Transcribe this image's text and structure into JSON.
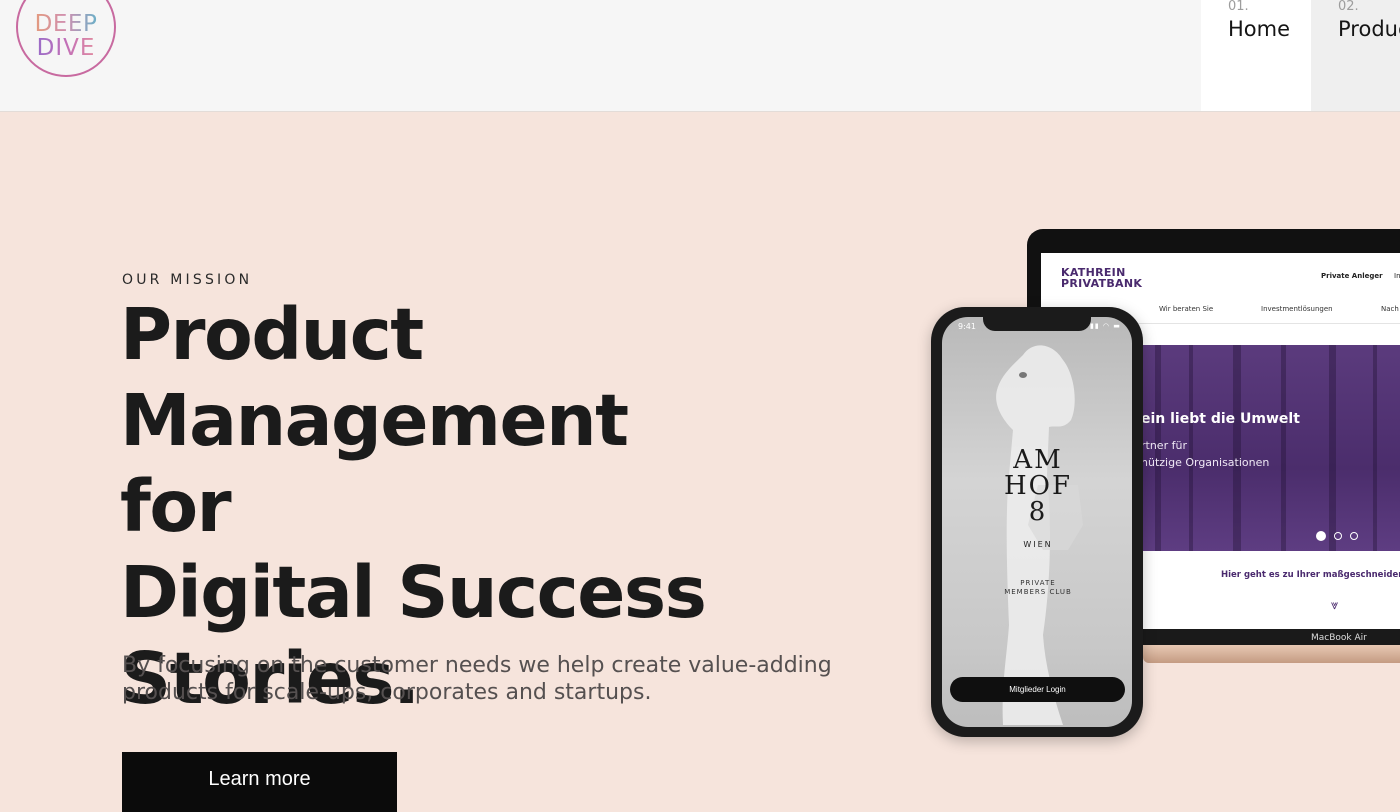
{
  "header": {
    "logo_line1": "DEEP",
    "logo_line2": "DIVE",
    "nav": [
      {
        "num": "01.",
        "label": "Home"
      },
      {
        "num": "02.",
        "label": "Products"
      }
    ]
  },
  "hero": {
    "eyebrow": "OUR MISSION",
    "headline_lines": [
      "Product",
      "Management for",
      "Digital Success",
      "Stories."
    ],
    "subtitle_lines": [
      "By focusing on the customer needs we help create value-adding",
      "products for scale-ups, corporates and startups."
    ],
    "cta_label": "Learn more"
  },
  "laptop": {
    "brand_line1": "KATHREIN",
    "brand_line2": "PRIVATBANK",
    "top_link1": "Private Anleger",
    "top_link2": "In",
    "nav": [
      "Wir beraten Sie",
      "Investmentlösungen",
      "Nach"
    ],
    "hero_heading": "ein liebt die Umwelt",
    "hero_text1": "rtner für",
    "hero_text2": "nützige Organisationen",
    "footer_text": "Hier geht es zu Ihrer maßgeschneiderte",
    "model_label": "MacBook Air"
  },
  "phone": {
    "time": "9:41",
    "status": "▮▮ ◠ ▬",
    "logo_line1": "AM",
    "logo_line2": "HOF",
    "logo_line3": "8",
    "city": "WIEN",
    "club_line1": "PRIVATE",
    "club_line2": "MEMBERS CLUB",
    "login_label": "Mitglieder Login"
  },
  "colors": {
    "hero_bg": "#f6e4dc",
    "header_bg": "#f6f6f6",
    "cta_bg": "#0b0b0b",
    "bank_purple": "#4a2a6e"
  }
}
